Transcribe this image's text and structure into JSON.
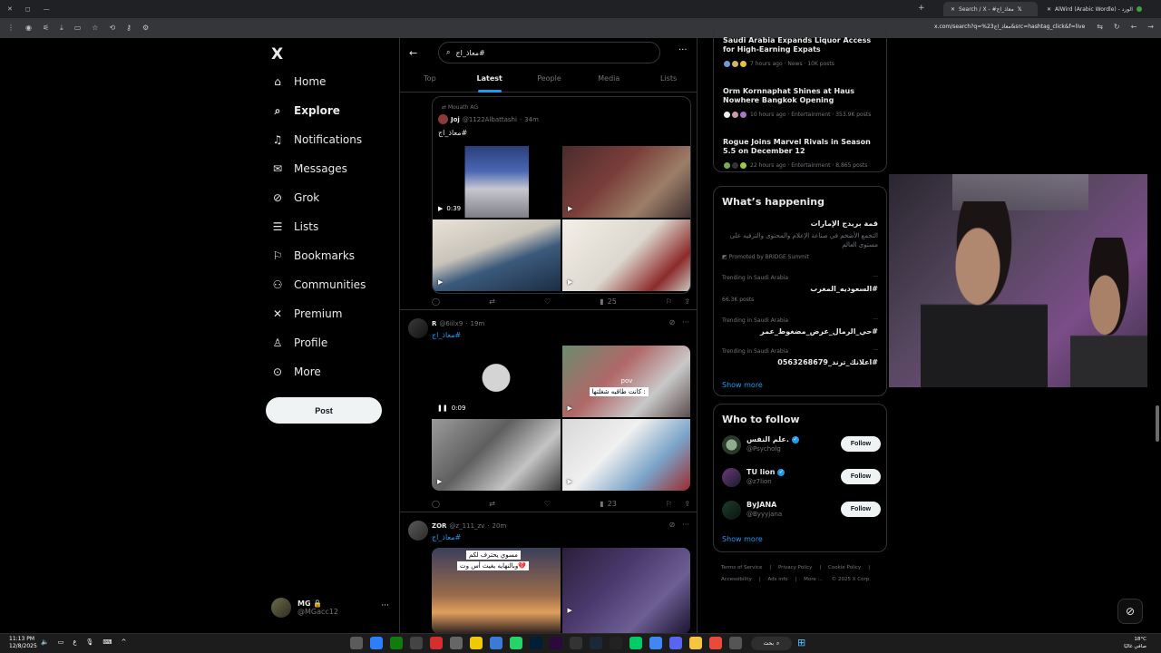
{
  "browser": {
    "tabs": [
      {
        "label": "Search / X - #معاذ_اج"
      },
      {
        "label": "AlWird (Arabic Wordle) - الورد"
      }
    ],
    "url": "x.com/search?q=%23معاذ_اج&src=hashtag_click&f=live"
  },
  "nav": {
    "logo": "X",
    "items": [
      {
        "label": "Home",
        "icon": "home-icon"
      },
      {
        "label": "Explore",
        "icon": "search-icon"
      },
      {
        "label": "Notifications",
        "icon": "bell-icon"
      },
      {
        "label": "Messages",
        "icon": "envelope-icon"
      },
      {
        "label": "Grok",
        "icon": "grok-icon"
      },
      {
        "label": "Lists",
        "icon": "list-icon"
      },
      {
        "label": "Bookmarks",
        "icon": "bookmark-icon"
      },
      {
        "label": "Communities",
        "icon": "people-icon"
      },
      {
        "label": "Premium",
        "icon": "x-icon"
      },
      {
        "label": "Profile",
        "icon": "person-icon"
      },
      {
        "label": "More",
        "icon": "more-circle-icon"
      }
    ],
    "post_label": "Post",
    "account": {
      "name": "MG",
      "handle": "@MGacc12"
    }
  },
  "feed": {
    "search_value": "#معاذ_اج",
    "tabs": [
      "Top",
      "Latest",
      "People",
      "Media",
      "Lists"
    ],
    "active_tab": "Latest",
    "tweets": [
      {
        "reposted_by": "Mouath AG",
        "name": "Joj",
        "handle": "@1122Albattashi",
        "time": "34m",
        "text": "#معاذ_اج",
        "video_time": "0:39",
        "views": "25"
      },
      {
        "name": "R",
        "handle": "@6iilx9",
        "time": "19m",
        "text": "#معاذ_اج",
        "video_time": "0:09",
        "caption_a": "pov",
        "caption_b": "كانت طاقيه شغلتها :",
        "views": "23"
      },
      {
        "name": "ZOR",
        "handle": "@z_111_zv",
        "time": "20m",
        "text": "#معاذ_اج",
        "caption_a": "مسوي يحترف لكم",
        "caption_b": "وبالنهايه يغيث أس وت💔"
      }
    ]
  },
  "right": {
    "news": [
      {
        "title": "Saudi Arabia Expands Liquor Access for High-Earning Expats",
        "meta": "7 hours ago · News · 10K posts"
      },
      {
        "title": "Orm Kornnaphat Shines at Haus Nowhere Bangkok Opening",
        "meta": "10 hours ago · Entertainment · 353.9K posts"
      },
      {
        "title": "Rogue Joins Marvel Rivals in Season 5.5 on December 12",
        "meta": "22 hours ago · Entertainment · 8,865 posts"
      }
    ],
    "happening": {
      "heading": "What’s happening",
      "promo_title": "قمة بريدج الإمارات",
      "promo_desc": "التجمع الأضخم في صناعة الإعلام والمحتوى والترفيه على مستوى العالم",
      "promo_by": "Promoted by BRIDGE Summit",
      "trends": [
        {
          "context": "Trending in Saudi Arabia",
          "name": "#السعوديه_المغرب",
          "count": "66.3K posts"
        },
        {
          "context": "Trending in Saudi Arabia",
          "name": "#حي_الرمال_عرض_مضغوط_عمر",
          "count": ""
        },
        {
          "context": "Trending in Saudi Arabia",
          "name": "#اعلانك_ترند_0563268679",
          "count": ""
        }
      ],
      "show_more": "Show more"
    },
    "who_to_follow": {
      "heading": "Who to follow",
      "users": [
        {
          "name": "علم النفس.",
          "handle": "@Psycholg",
          "verified": true
        },
        {
          "name": "TU lion",
          "handle": "@z7lion",
          "verified": true
        },
        {
          "name": "ByJANA",
          "handle": "@Byyyjana",
          "verified": false
        }
      ],
      "follow_label": "Follow",
      "show_more": "Show more"
    },
    "footer": [
      "Terms of Service",
      "Privacy Policy",
      "Cookie Policy",
      "Accessibility",
      "Ads info",
      "More …",
      "© 2025 X Corp."
    ]
  },
  "taskbar": {
    "time": "11:13 PM",
    "date": "12/8/2025",
    "search_label": "بحث",
    "weather_temp": "18°C",
    "weather_desc": "صافي غالبًا"
  }
}
